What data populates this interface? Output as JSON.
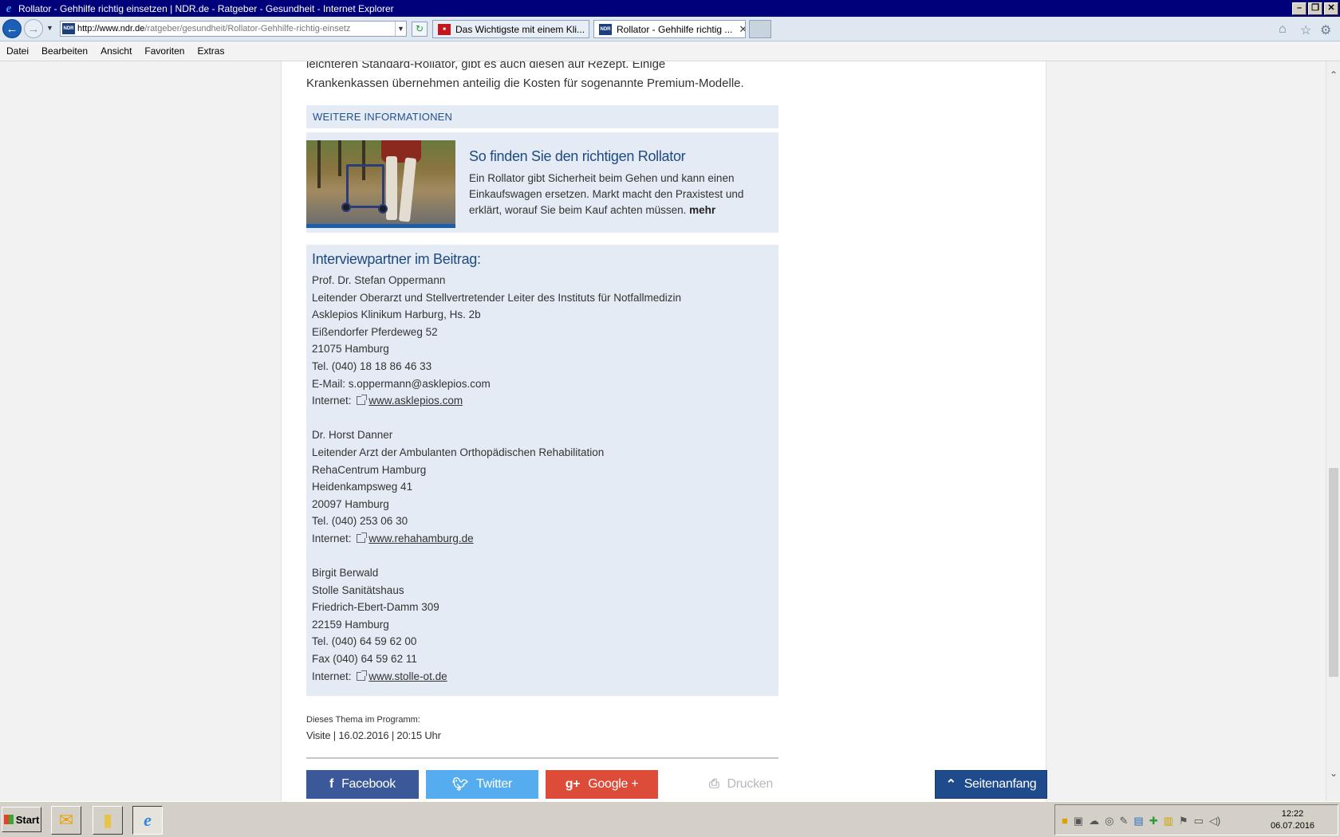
{
  "window": {
    "title": "Rollator - Gehhilfe richtig einsetzen | NDR.de - Ratgeber - Gesundheit - Internet Explorer"
  },
  "browser": {
    "url_host": "http://www.ndr.de",
    "url_path": "/ratgeber/gesundheit/Rollator-Gehhilfe-richtig-einsetz",
    "tabs": [
      {
        "label": "Das Wichtigste mit einem Kli..."
      },
      {
        "label": "Rollator - Gehhilfe richtig ..."
      }
    ]
  },
  "menu": [
    "Datei",
    "Bearbeiten",
    "Ansicht",
    "Favoriten",
    "Extras"
  ],
  "article": {
    "intro_line1": "leichteren Standard-Rollator, gibt es auch diesen auf Rezept. Einige",
    "intro_line2": "Krankenkassen übernehmen anteilig die Kosten für sogenannte Premium-Modelle."
  },
  "weitere": {
    "heading": "WEITERE INFORMATIONEN",
    "card_title": "So finden Sie den richtigen Rollator",
    "card_text": "Ein Rollator gibt Sicherheit beim Gehen und kann einen Einkaufswagen ersetzen. Markt macht den Praxistest und erklärt, worauf Sie beim Kauf achten müssen. ",
    "card_more": "mehr"
  },
  "interview": {
    "heading": "Interviewpartner im Beitrag:",
    "p1": {
      "name": "Prof. Dr. Stefan Oppermann",
      "role": "Leitender Oberarzt und Stellvertretender Leiter des Instituts für Notfallmedizin",
      "org": "Asklepios Klinikum Harburg, Hs. 2b",
      "street": "Eißendorfer Pferdeweg 52",
      "city": "21075 Hamburg",
      "tel": "Tel.  (040) 18 18 86 46 33",
      "email": "E-Mail: s.oppermann@asklepios.com",
      "internet_label": "Internet: ",
      "link": "www.asklepios.com"
    },
    "p2": {
      "name": "Dr. Horst Danner",
      "role": "Leitender Arzt der Ambulanten Orthopädischen Rehabilitation",
      "org": "RehaCentrum Hamburg",
      "street": "Heidenkampsweg 41",
      "city": "20097 Hamburg",
      "tel": "Tel. (040) 253 06 30",
      "internet_label": "Internet: ",
      "link": "www.rehahamburg.de"
    },
    "p3": {
      "name": "Birgit Berwald",
      "org": "Stolle Sanitätshaus",
      "street": "Friedrich-Ebert-Damm 309",
      "city": "22159 Hamburg",
      "tel": "Tel. (040) 64 59 62 00",
      "fax": "Fax (040) 64 59 62 11",
      "internet_label": "Internet: ",
      "link": "www.stolle-ot.de"
    }
  },
  "program": {
    "label": "Dieses Thema im Programm:",
    "info": "Visite | 16.02.2016 | 20:15 Uhr"
  },
  "share": {
    "facebook": "Facebook",
    "twitter": "Twitter",
    "google": "Google +",
    "print": "Drucken",
    "top": "Seitenanfang"
  },
  "taskbar": {
    "start": "Start",
    "time": "12:22",
    "date": "06.07.2016"
  }
}
